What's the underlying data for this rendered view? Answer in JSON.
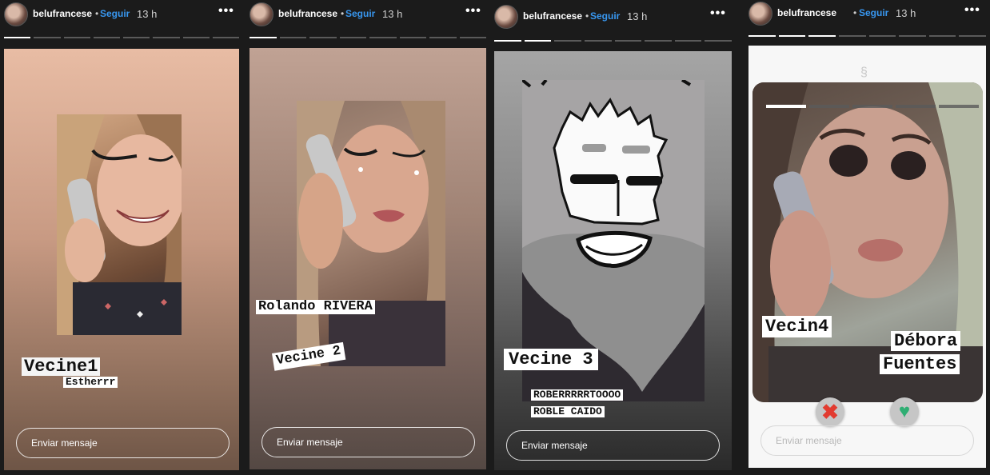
{
  "stories": [
    {
      "username": "belufrancese",
      "follow_label": "Seguir",
      "time": "13 h",
      "progress": {
        "segments": 8,
        "active": 1
      },
      "stickers": [
        "Vecine1",
        "Estherrr"
      ],
      "reply_placeholder": "Enviar mensaje"
    },
    {
      "username": "belufrancese",
      "follow_label": "Seguir",
      "time": "13 h",
      "progress": {
        "segments": 8,
        "active": 2
      },
      "stickers": [
        "Rolando RIVERA",
        "Vecine 2"
      ],
      "reply_placeholder": "Enviar mensaje"
    },
    {
      "username": "belufrancese",
      "follow_label": "Seguir",
      "time": "13 h",
      "progress": {
        "segments": 8,
        "active": 3
      },
      "stickers": [
        "Vecine 3",
        "ROBERRRRRTOOOO",
        "ROBLE CAIDO"
      ],
      "reply_placeholder": "Enviar mensaje"
    },
    {
      "username": "belufrancese",
      "follow_label": "Seguir",
      "time": "13 h",
      "progress": {
        "segments": 8,
        "active": 4
      },
      "stickers": [
        "Vecin4",
        "Débora",
        "Fuentes"
      ],
      "reply_placeholder": "Enviar mensaje",
      "inner_progress": {
        "segments": 5,
        "active": 1
      },
      "reactions": [
        "close-icon",
        "heart-icon"
      ]
    }
  ],
  "separator": "•",
  "more_icon": "more-options-icon",
  "colors": {
    "link": "#3897f0",
    "background": "#1b1b1b"
  }
}
